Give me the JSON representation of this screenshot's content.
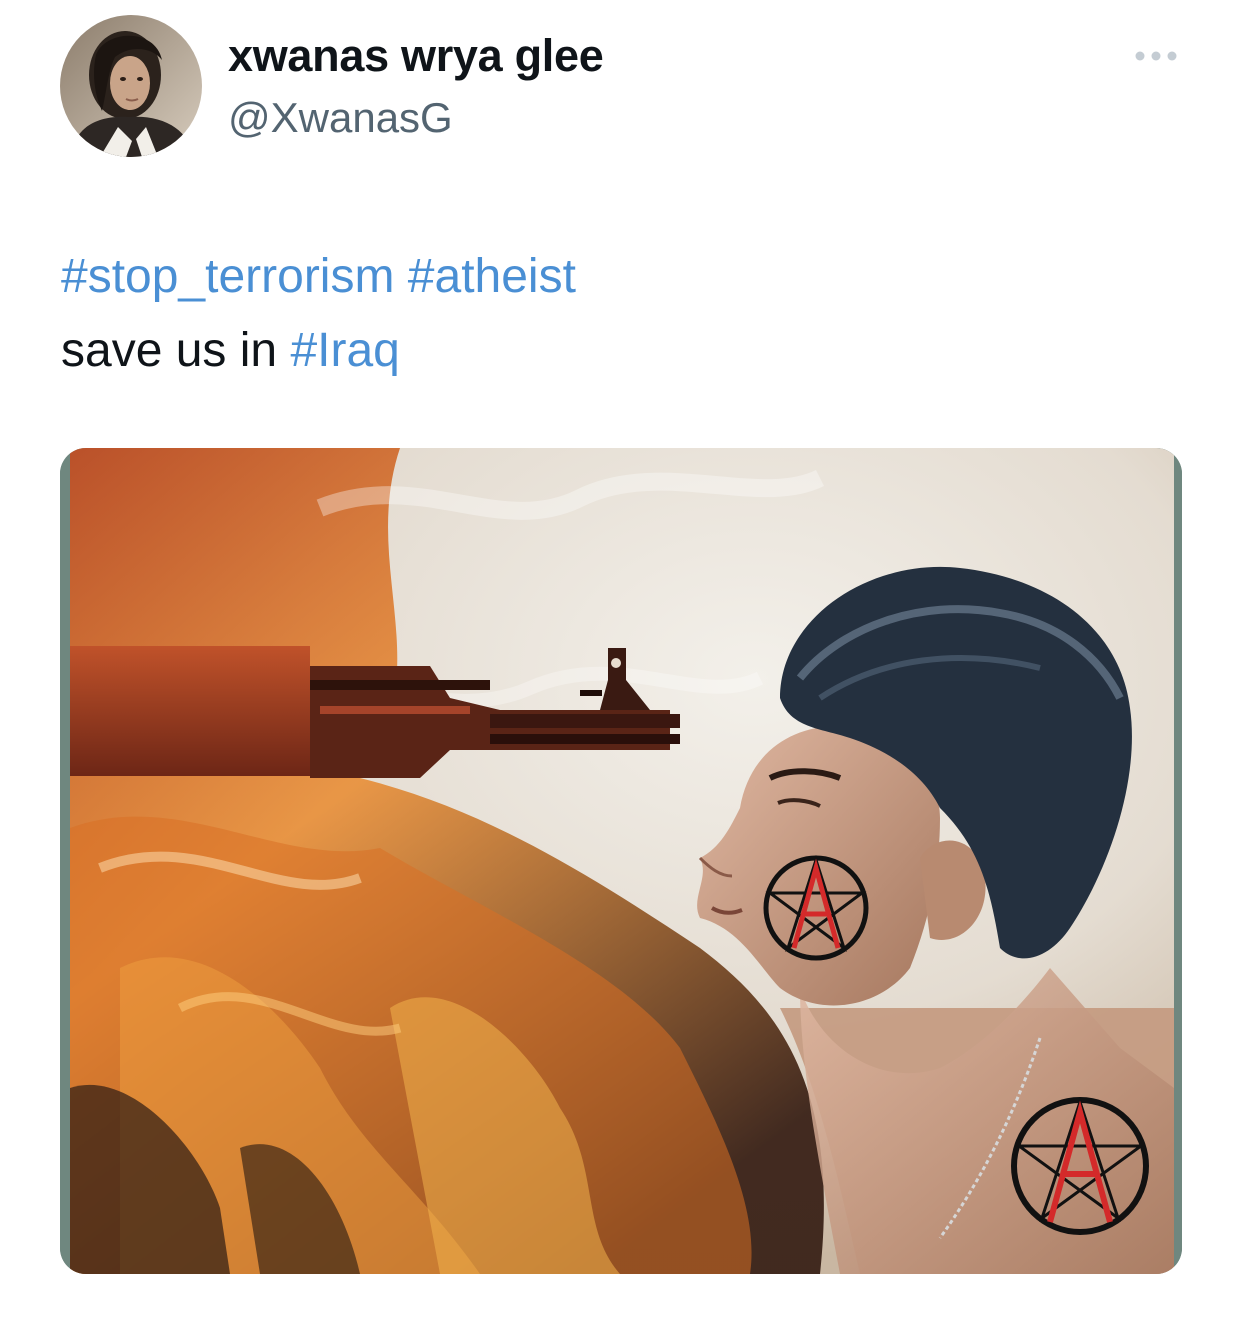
{
  "tweet": {
    "author": {
      "display_name": "xwanas wrya glee",
      "handle": "@XwanasG"
    },
    "text": {
      "line1": [
        {
          "type": "hashtag",
          "text": "#stop_terrorism"
        },
        {
          "type": "text",
          "text": " "
        },
        {
          "type": "hashtag",
          "text": "#atheist"
        }
      ],
      "line2": [
        {
          "type": "text",
          "text": "save us in "
        },
        {
          "type": "hashtag",
          "text": "#Iraq"
        }
      ]
    },
    "media": {
      "kind": "photo"
    }
  },
  "icons": {
    "more": "more-horizontal-icon"
  },
  "colors": {
    "hashtag": "#4a8fd4",
    "text": "#0f1419",
    "secondary": "#536471"
  }
}
